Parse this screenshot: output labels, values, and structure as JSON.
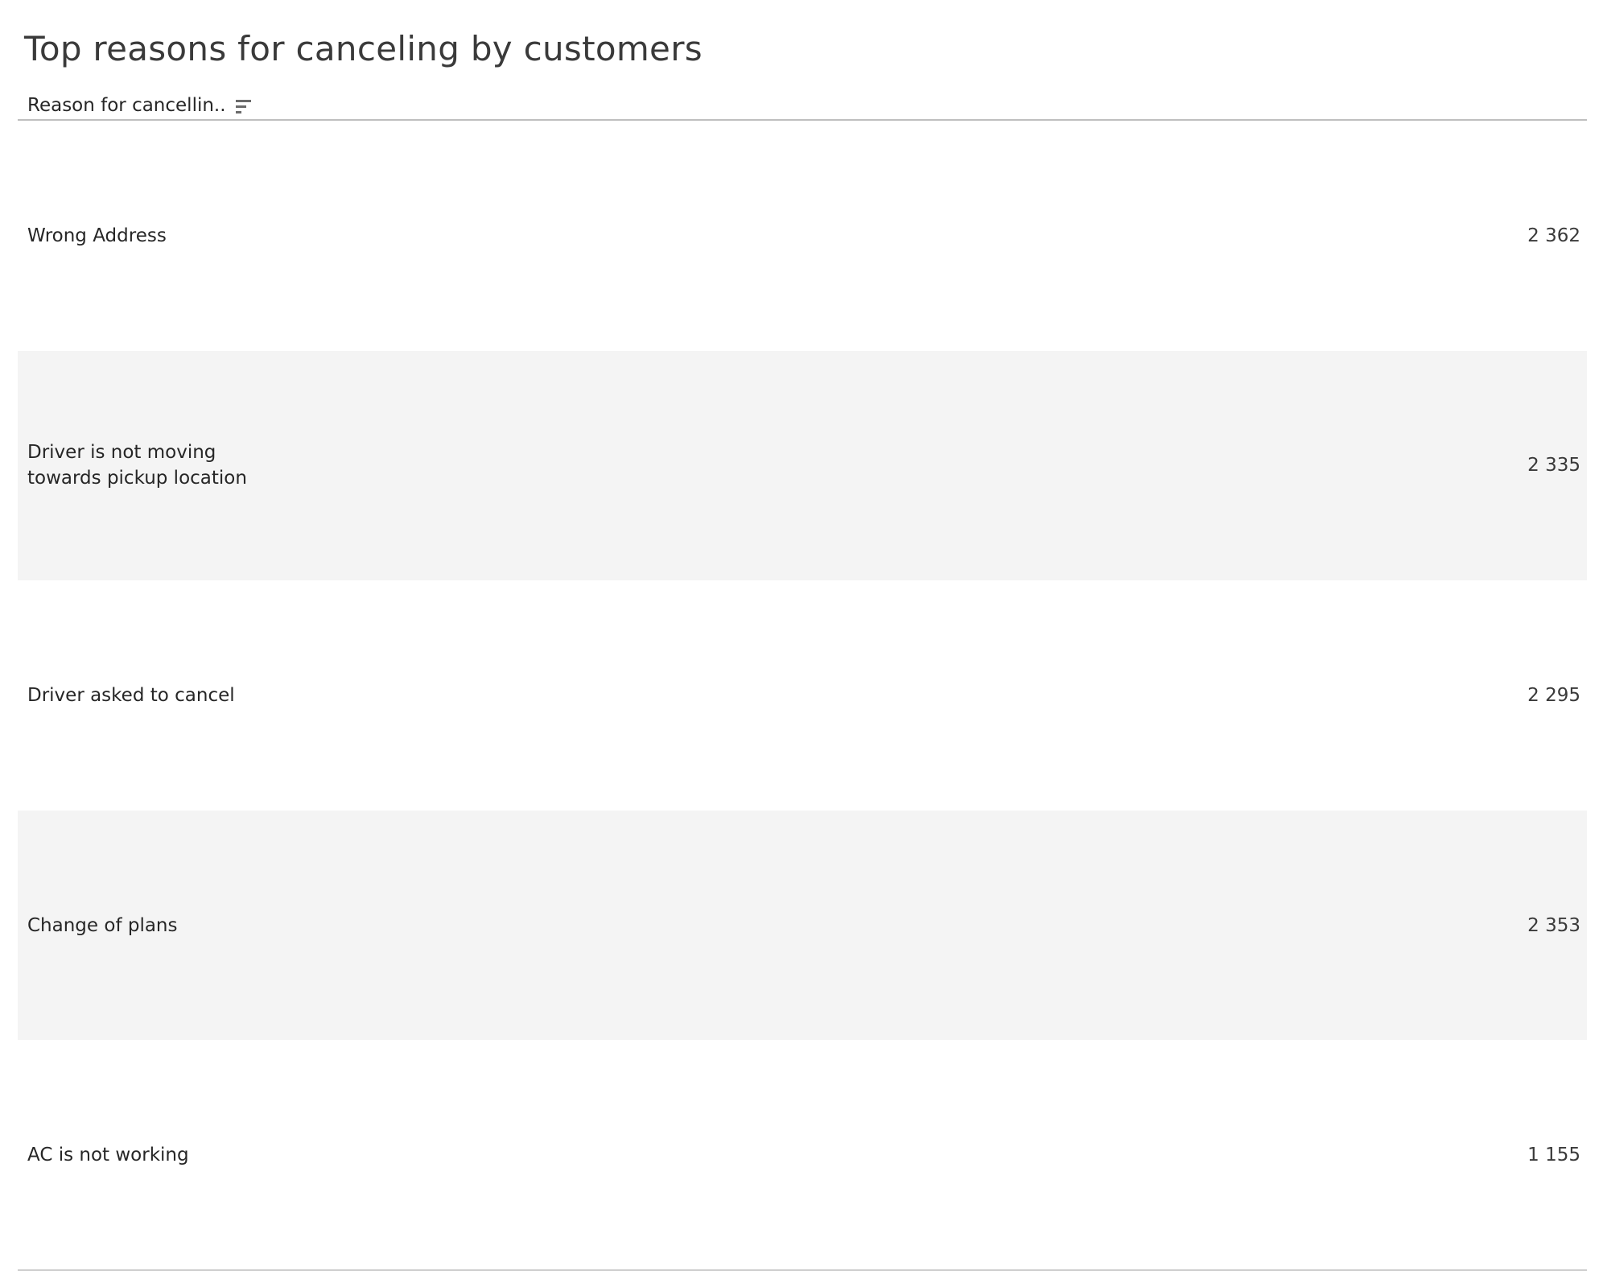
{
  "sheet": {
    "title": "Top reasons for canceling by customers"
  },
  "header": {
    "column_label": "Reason for cancellin..",
    "sort_icon": "sort-descending-icon"
  },
  "table": {
    "rows": [
      {
        "reason": "Wrong Address",
        "count": "2 362"
      },
      {
        "reason": "Driver is not moving towards pickup location",
        "count": "2 335"
      },
      {
        "reason": "Driver asked to cancel",
        "count": "2 295"
      },
      {
        "reason": "Change of plans",
        "count": "2 353"
      },
      {
        "reason": "AC is not working",
        "count": "1 155"
      }
    ]
  },
  "colors": {
    "band_shade": "#f4f4f4",
    "rule": "#bfbfbf",
    "text": "#262626"
  }
}
